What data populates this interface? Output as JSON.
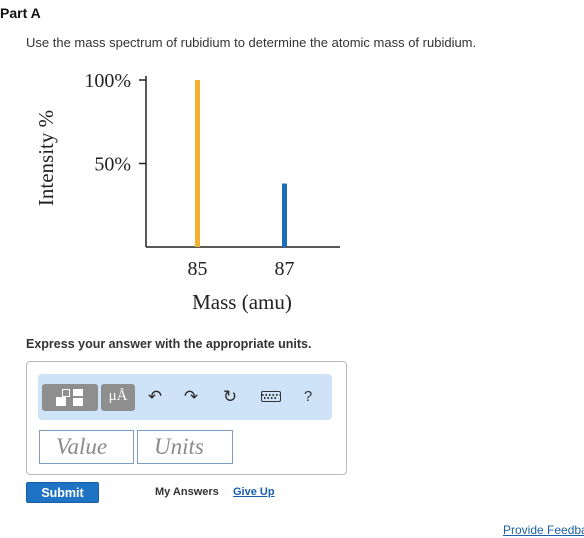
{
  "part": {
    "title": "Part A"
  },
  "question": {
    "text": "Use the mass spectrum of rubidium to determine the atomic mass of rubidium."
  },
  "chart_data": {
    "type": "bar",
    "ylabel": "Intensity %",
    "xlabel": "Mass (amu)",
    "y_ticks": [
      "100%",
      "50%"
    ],
    "y_tick_values": [
      100,
      50
    ],
    "ylim": [
      0,
      100
    ],
    "x_ticks": [
      "85",
      "87"
    ],
    "x_tick_values": [
      85,
      87
    ],
    "xlim": [
      84,
      88
    ],
    "grid": false,
    "bars": [
      {
        "x": 85,
        "value": 100,
        "color": "#f0b030"
      },
      {
        "x": 87,
        "value": 38,
        "color": "#1a6fb8"
      }
    ]
  },
  "prompt": {
    "express": "Express your answer with the appropriate units."
  },
  "toolbar": {
    "template_icon": "template-icon",
    "units_glyph": "μÅ",
    "undo_icon": "undo-icon",
    "redo_icon": "redo-icon",
    "reset_icon": "reset-icon",
    "keyboard_icon": "keyboard-icon",
    "help": "?"
  },
  "inputs": {
    "value_placeholder": "Value",
    "units_placeholder": "Units"
  },
  "actions": {
    "submit": "Submit",
    "my_answers": "My Answers",
    "give_up": "Give Up",
    "feedback": "Provide Feedback"
  },
  "colors": {
    "accent": "#1f73c4",
    "toolbar_bg": "#cfe3f8",
    "bar_85": "#f0b030",
    "bar_87": "#1a6fb8"
  }
}
